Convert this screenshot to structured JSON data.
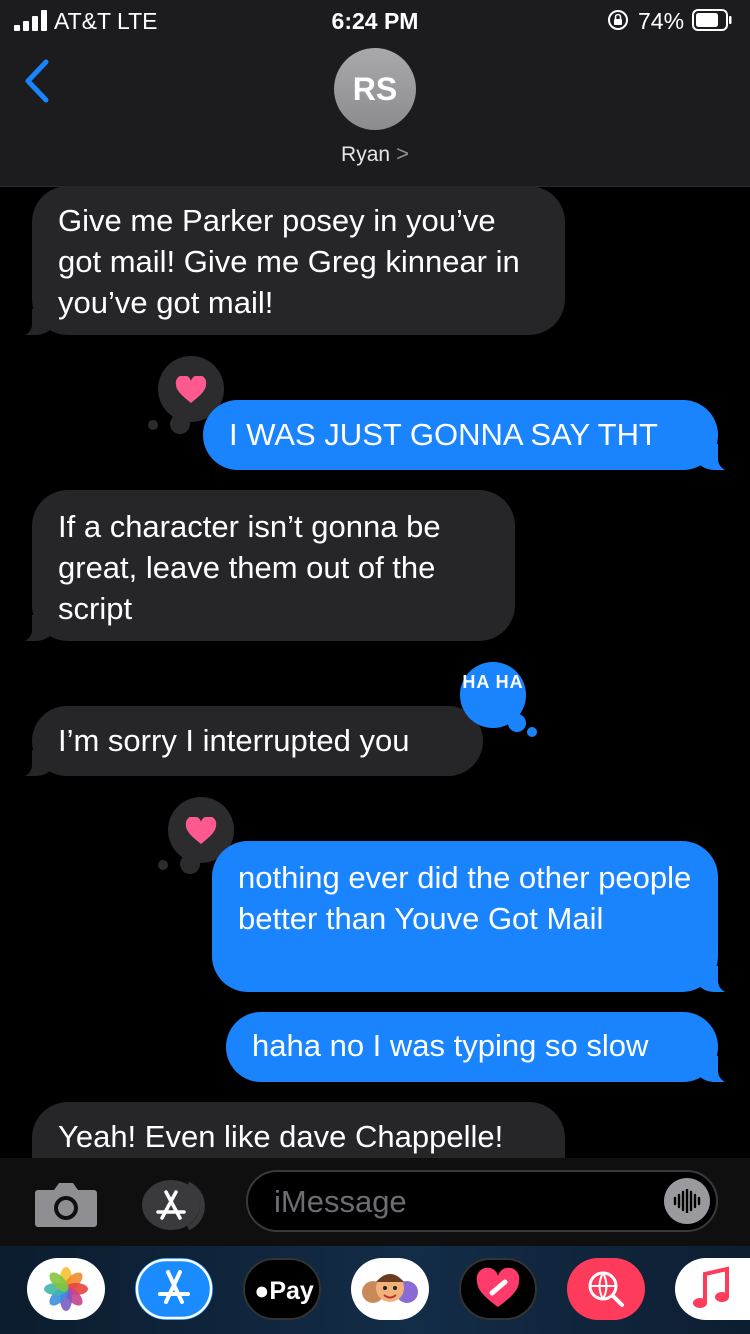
{
  "status_bar": {
    "carrier": "AT&T   LTE",
    "time": "6:24 PM",
    "battery": "74%"
  },
  "header": {
    "back_icon": "chevron-left-icon",
    "avatar_initials": "RS",
    "contact_name": "Ryan",
    "contact_chevron": ">"
  },
  "messages": [
    {
      "direction": "incoming",
      "text": "Give me Parker posey in you’ve got mail! Give me Greg kinnear in you’ve got mail!"
    },
    {
      "direction": "outgoing",
      "text": "I WAS JUST GONNA SAY THT",
      "tapback": "heart"
    },
    {
      "direction": "incoming",
      "text": "If a character isn’t gonna be great, leave them out of the script"
    },
    {
      "direction": "incoming",
      "text": "I’m sorry I interrupted you",
      "tapback": "haha",
      "tapback_text": "HA HA"
    },
    {
      "direction": "outgoing",
      "text": "nothing ever did the other people better than Youve Got Mail",
      "tapback": "heart"
    },
    {
      "direction": "outgoing",
      "text": "haha no I was typing so slow"
    },
    {
      "direction": "incoming",
      "text": "Yeah! Even like dave Chappelle!"
    }
  ],
  "compose": {
    "camera_icon": "camera-icon",
    "apps_icon": "app-store-icon",
    "placeholder": "iMessage",
    "audio_icon": "waveform-icon"
  },
  "app_drawer": {
    "apps": [
      "Photos",
      "App Store",
      "Apple Pay",
      "Memoji",
      "Digital Touch",
      "Images",
      "Music"
    ],
    "pay_label": "Pay"
  },
  "colors": {
    "outgoing_bubble": "#1a84ff",
    "incoming_bubble": "#262628",
    "heart": "#ff5a8f",
    "header_bg": "#1c1c1e"
  }
}
